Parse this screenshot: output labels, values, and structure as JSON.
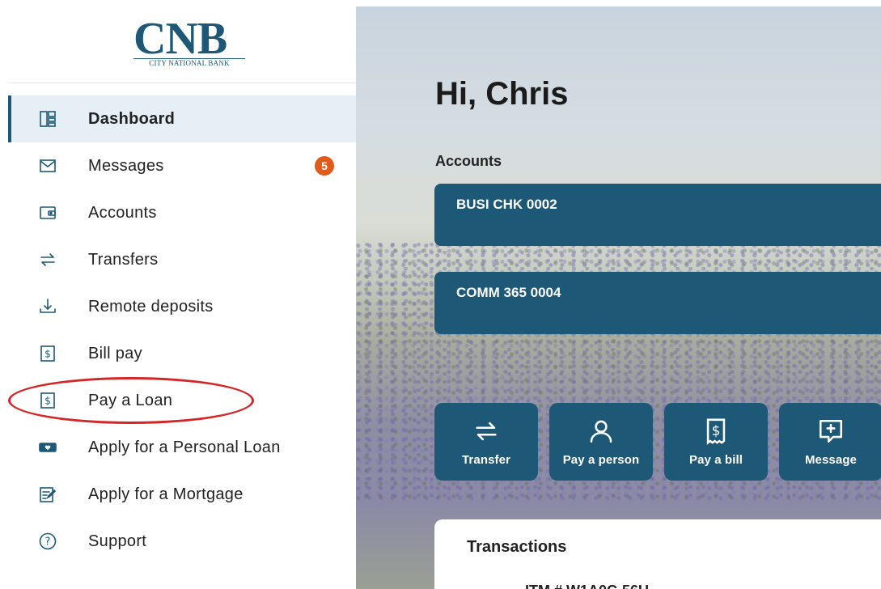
{
  "logo": {
    "word": "CNB",
    "subtitle": "CITY NATIONAL BANK"
  },
  "sidebar": {
    "items": [
      {
        "label": "Dashboard",
        "icon": "dashboard-icon",
        "active": true
      },
      {
        "label": "Messages",
        "icon": "envelope-icon",
        "badge": "5"
      },
      {
        "label": "Accounts",
        "icon": "wallet-icon"
      },
      {
        "label": "Transfers",
        "icon": "transfer-arrows-icon"
      },
      {
        "label": "Remote deposits",
        "icon": "download-tray-icon"
      },
      {
        "label": "Bill pay",
        "icon": "dollar-receipt-icon"
      },
      {
        "label": "Pay a Loan",
        "icon": "dollar-receipt-icon",
        "highlighted": true
      },
      {
        "label": "Apply for a Personal Loan",
        "icon": "money-bill-icon"
      },
      {
        "label": "Apply for a Mortgage",
        "icon": "form-edit-icon"
      },
      {
        "label": "Support",
        "icon": "question-circle-icon"
      }
    ]
  },
  "main": {
    "greeting": "Hi, Chris",
    "accounts_label": "Accounts",
    "accounts": [
      {
        "name": "BUSI CHK 0002"
      },
      {
        "name": "COMM 365 0004"
      }
    ],
    "quick_actions": [
      {
        "label": "Transfer",
        "icon": "transfer-arrows-icon"
      },
      {
        "label": "Pay a person",
        "icon": "person-icon"
      },
      {
        "label": "Pay a bill",
        "icon": "dollar-receipt-icon"
      },
      {
        "label": "Message",
        "icon": "message-plus-icon"
      }
    ],
    "transactions_title": "Transactions",
    "transactions_peek": "ITM # W1A0C-56U"
  },
  "colors": {
    "brand": "#1d5877",
    "badge": "#e05a1c",
    "highlight_oval": "#d42626",
    "active_bg": "#e6eff5"
  }
}
